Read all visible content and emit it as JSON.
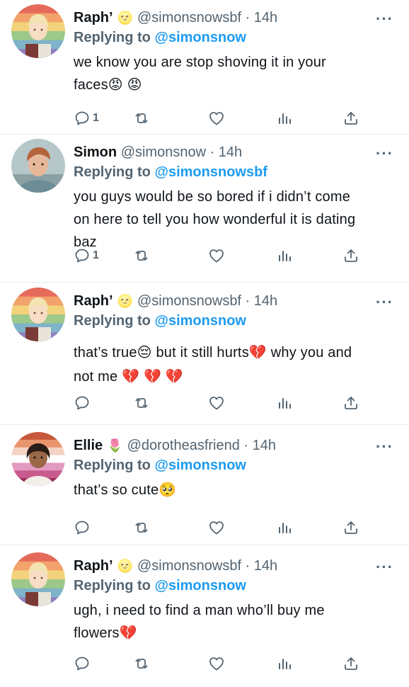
{
  "tweets": [
    {
      "name": "Raph’",
      "name_emoji": "🌝",
      "handle": "@simonsnowsbf",
      "time": "· 14h",
      "reply_prefix": "Replying to",
      "reply_to": "@simonsnow",
      "text_lines": [
        "we know you are stop shoving it in your",
        "faces😡 😡"
      ],
      "reply_count": "1",
      "avatar": "raph"
    },
    {
      "name": "Simon",
      "name_emoji": "",
      "handle": "@simonsnow",
      "time": "· 14h",
      "reply_prefix": "Replying to",
      "reply_to": "@simonsnowsbf",
      "text_lines": [
        "you guys would be so bored if i didn’t come",
        "on here to tell you how wonderful it is dating",
        "baz"
      ],
      "reply_count": "1",
      "avatar": "simon"
    },
    {
      "name": "Raph’",
      "name_emoji": "🌝",
      "handle": "@simonsnowsbf",
      "time": "· 14h",
      "reply_prefix": "Replying to",
      "reply_to": "@simonsnow",
      "text_lines": [
        "that’s true😔  but it still hurts💔  why you and",
        "not me 💔 💔 💔"
      ],
      "reply_count": "",
      "avatar": "raph"
    },
    {
      "name": "Ellie",
      "name_emoji": "🌷",
      "handle": "@dorotheasfriend",
      "time": "· 14h",
      "reply_prefix": "Replying to",
      "reply_to": "@simonsnow",
      "text_lines": [
        "that’s so cute🥺"
      ],
      "reply_count": "",
      "avatar": "ellie"
    },
    {
      "name": "Raph’",
      "name_emoji": "🌝",
      "handle": "@simonsnowsbf",
      "time": "· 14h",
      "reply_prefix": "Replying to",
      "reply_to": "@simonsnow",
      "text_lines": [
        "ugh, i need to find a man who’ll buy me",
        "flowers💔"
      ],
      "reply_count": "",
      "avatar": "raph"
    }
  ],
  "icons": {
    "more": "more-dots-icon",
    "reply": "reply-bubble-icon",
    "retweet": "retweet-icon",
    "like": "heart-icon",
    "analytics": "analytics-bars-icon",
    "share": "share-upload-icon"
  },
  "colors": {
    "link": "#1d9bf0",
    "muted": "#536471",
    "text": "#0f1419"
  }
}
